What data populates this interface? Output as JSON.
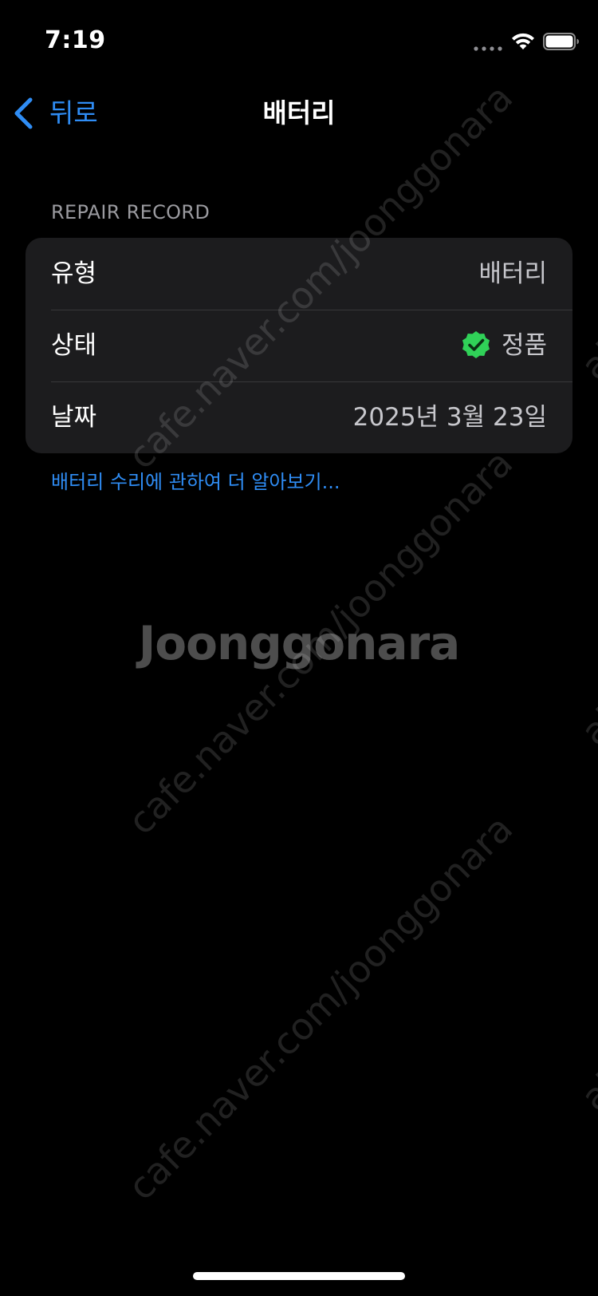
{
  "status_bar": {
    "time": "7:19"
  },
  "nav": {
    "back_label": "뒤로",
    "title": "배터리"
  },
  "section": {
    "header": "REPAIR RECORD"
  },
  "rows": [
    {
      "label": "유형",
      "value": "배터리"
    },
    {
      "label": "상태",
      "value": "정품"
    },
    {
      "label": "날짜",
      "value": "2025년 3월 23일"
    }
  ],
  "learn_more": "배터리 수리에 관하여 더 알아보기...",
  "watermark": {
    "logo": "Joonggonara",
    "url": "cafe.naver.com/joonggonara",
    "side": "ait"
  },
  "colors": {
    "accent": "#2f8df5",
    "check_green": "#30d158",
    "card_bg": "#1c1c1e"
  },
  "icons": {
    "back": "chevron-left-icon",
    "status": "check-badge-icon",
    "wifi": "wifi-icon",
    "battery": "battery-icon",
    "signal": "signal-dots-icon"
  }
}
